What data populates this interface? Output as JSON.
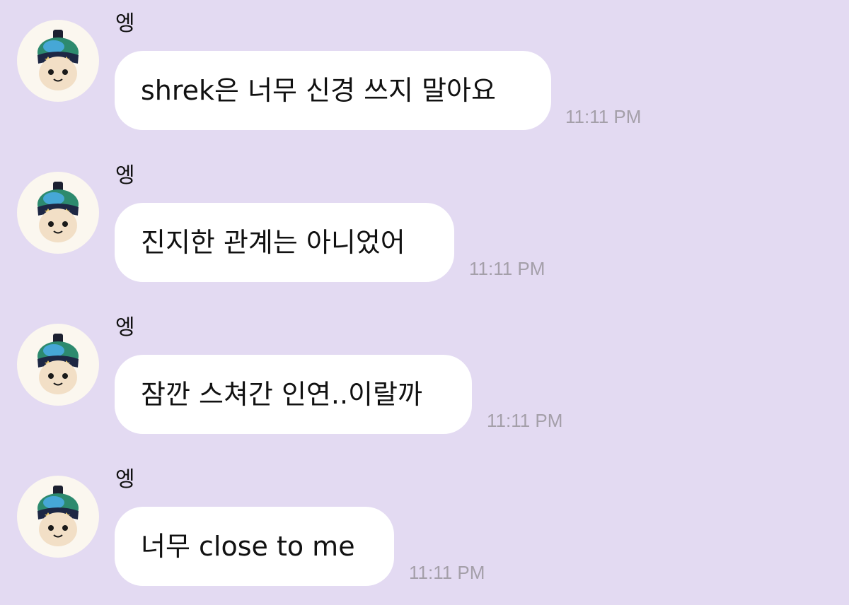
{
  "messages": [
    {
      "sender": "엥",
      "text": "shrek은 너무 신경 쓰지 말아요",
      "time": "11:11 PM",
      "avatar_icon": "plush-doll-avatar-icon"
    },
    {
      "sender": "엥",
      "text": "진지한 관계는 아니었어",
      "time": "11:11 PM",
      "avatar_icon": "plush-doll-avatar-icon"
    },
    {
      "sender": "엥",
      "text": "잠깐 스쳐간 인연..이랄까",
      "time": "11:11 PM",
      "avatar_icon": "plush-doll-avatar-icon"
    },
    {
      "sender": "엥",
      "text": "너무 close to me",
      "time": "11:11 PM",
      "avatar_icon": "plush-doll-avatar-icon"
    }
  ],
  "colors": {
    "background": "#e3daf2",
    "bubble": "#ffffff",
    "timestamp": "#a49fa9",
    "avatar_background": "#fbf7ef"
  }
}
